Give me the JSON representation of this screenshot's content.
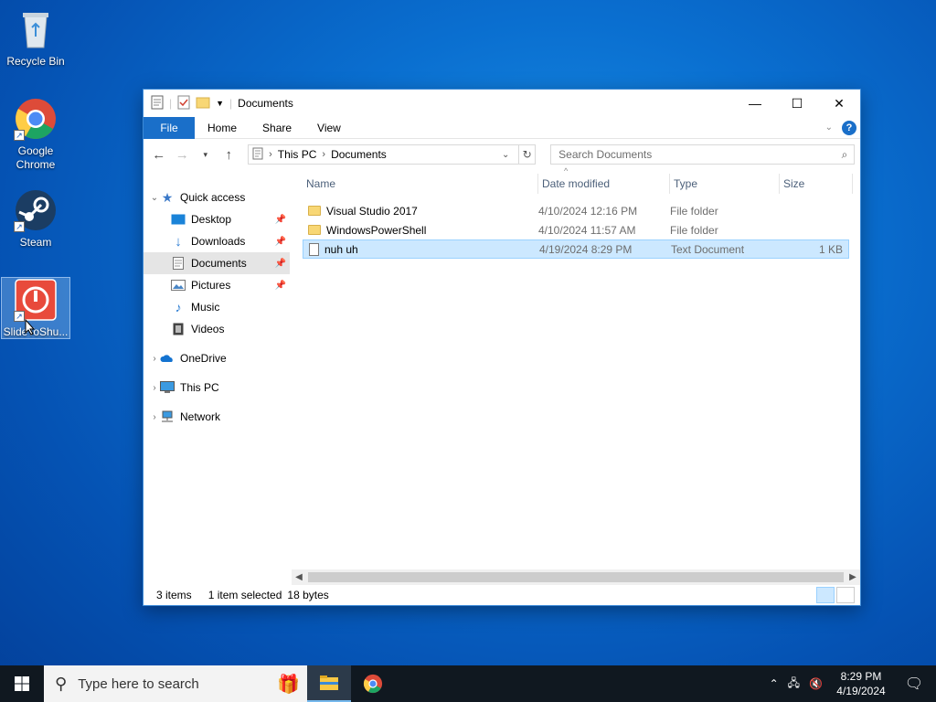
{
  "desktop": {
    "icons": [
      {
        "label": "Recycle Bin"
      },
      {
        "label": "Google Chrome"
      },
      {
        "label": "Steam"
      },
      {
        "label": "SlideToShu..."
      }
    ]
  },
  "window": {
    "title": "Documents",
    "ribbon_tabs": [
      "File",
      "Home",
      "Share",
      "View"
    ],
    "address": {
      "segments": [
        "This PC",
        "Documents"
      ]
    },
    "search_placeholder": "Search Documents",
    "nav": {
      "quick_access": "Quick access",
      "quick_items": [
        "Desktop",
        "Downloads",
        "Documents",
        "Pictures",
        "Music",
        "Videos"
      ],
      "onedrive": "OneDrive",
      "this_pc": "This PC",
      "network": "Network"
    },
    "columns": {
      "name": "Name",
      "date": "Date modified",
      "type": "Type",
      "size": "Size"
    },
    "files": [
      {
        "name": "Visual Studio 2017",
        "date": "4/10/2024 12:16 PM",
        "type": "File folder",
        "size": ""
      },
      {
        "name": "WindowsPowerShell",
        "date": "4/10/2024 11:57 AM",
        "type": "File folder",
        "size": ""
      },
      {
        "name": "nuh uh",
        "date": "4/19/2024 8:29 PM",
        "type": "Text Document",
        "size": "1 KB"
      }
    ],
    "status": {
      "items": "3 items",
      "selected": "1 item selected",
      "bytes": "18 bytes"
    }
  },
  "taskbar": {
    "search_placeholder": "Type here to search",
    "time": "8:29 PM",
    "date": "4/19/2024"
  },
  "colors": {
    "accent": "#1a6fc9",
    "selection": "#cce8ff"
  }
}
